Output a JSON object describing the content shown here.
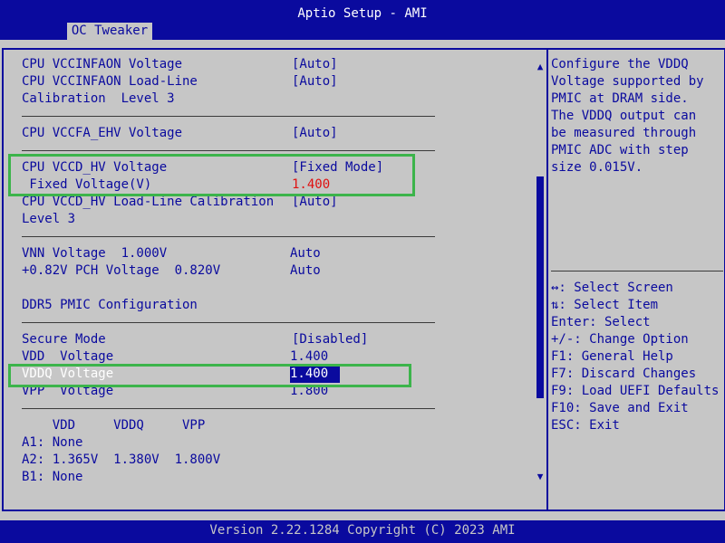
{
  "header": {
    "title": "Aptio Setup - AMI",
    "tab": "OC Tweaker"
  },
  "settings": [
    {
      "label": "CPU VCCINFAON Voltage",
      "value": "[Auto]"
    },
    {
      "label": "CPU VCCINFAON Load-Line",
      "value": "[Auto]"
    },
    {
      "label": "Calibration  Level 3"
    },
    {
      "label": "CPU VCCFA_EHV Voltage",
      "value": "[Auto]"
    },
    {
      "label": "CPU VCCD_HV Voltage",
      "value": "[Fixed Mode]"
    },
    {
      "label": " Fixed Voltage(V)",
      "value": "1.400"
    },
    {
      "label": "CPU VCCD_HV Load-Line Calibration",
      "value": "[Auto]"
    },
    {
      "label": "Level 3"
    },
    {
      "label": "VNN Voltage  1.000V",
      "value": "Auto"
    },
    {
      "label": "+0.82V PCH Voltage  0.820V",
      "value": "Auto"
    },
    {
      "label": "DDR5 PMIC Configuration"
    },
    {
      "label": "Secure Mode",
      "value": "[Disabled]"
    },
    {
      "label": "VDD  Voltage",
      "value": "1.400"
    },
    {
      "label": "VDDQ Voltage",
      "value": "1.400"
    },
    {
      "label": "VPP  Voltage",
      "value": "1.800"
    }
  ],
  "pmic_table": {
    "header": "    VDD     VDDQ     VPP",
    "rows": [
      "A1: None",
      "A2: 1.365V  1.380V  1.800V",
      "B1: None"
    ]
  },
  "help": {
    "lines": [
      "Configure the VDDQ",
      "Voltage supported by",
      "PMIC at DRAM side.",
      "The VDDQ output can",
      "be measured through",
      "PMIC ADC with step",
      "size 0.015V."
    ]
  },
  "keys": [
    "↔: Select Screen",
    "⇅: Select Item",
    "Enter: Select",
    "+/-: Change Option",
    "F1: General Help",
    "F7: Discard Changes",
    "F9: Load UEFI Defaults",
    "F10: Save and Exit",
    "ESC: Exit"
  ],
  "scrollbar": {
    "up": "▲",
    "down": "▼"
  },
  "footer": "Version 2.22.1284 Copyright (C) 2023 AMI",
  "colors": {
    "background": "#c6c6c6",
    "bar": "#0a0a9e",
    "highlight_box": "#3cb44b",
    "modified_value": "#e01010"
  }
}
